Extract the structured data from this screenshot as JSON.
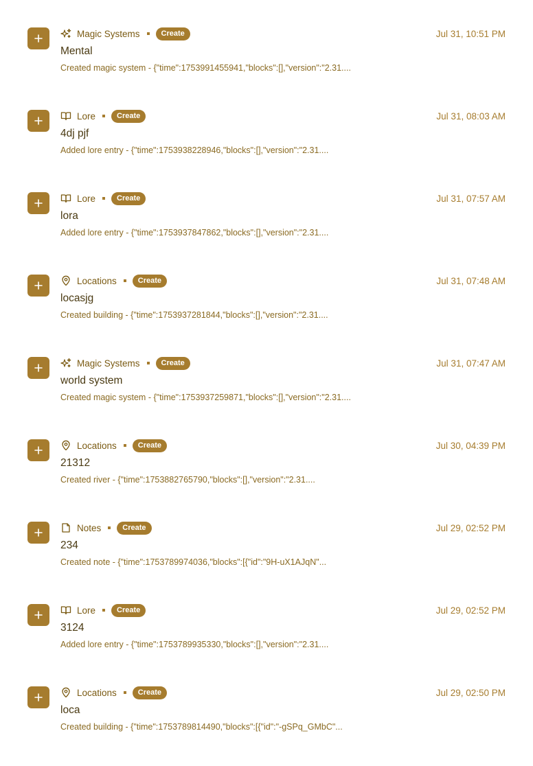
{
  "theme": {
    "accent": "#a67c2e",
    "text_dark": "#4a3a12",
    "text_muted": "#8a6a22"
  },
  "entries": [
    {
      "category": "Magic Systems",
      "category_icon": "sparkles-icon",
      "badge": "Create",
      "title": "Mental",
      "description": "Created magic system - {\"time\":1753991455941,\"blocks\":[],\"version\":\"2.31....",
      "timestamp": "Jul 31, 10:51 PM"
    },
    {
      "category": "Lore",
      "category_icon": "book-open-icon",
      "badge": "Create",
      "title": "4dj pjf",
      "description": "Added lore entry - {\"time\":1753938228946,\"blocks\":[],\"version\":\"2.31....",
      "timestamp": "Jul 31, 08:03 AM"
    },
    {
      "category": "Lore",
      "category_icon": "book-open-icon",
      "badge": "Create",
      "title": "lora",
      "description": "Added lore entry - {\"time\":1753937847862,\"blocks\":[],\"version\":\"2.31....",
      "timestamp": "Jul 31, 07:57 AM"
    },
    {
      "category": "Locations",
      "category_icon": "map-pin-icon",
      "badge": "Create",
      "title": "locasjg",
      "description": "Created building - {\"time\":1753937281844,\"blocks\":[],\"version\":\"2.31....",
      "timestamp": "Jul 31, 07:48 AM"
    },
    {
      "category": "Magic Systems",
      "category_icon": "sparkles-icon",
      "badge": "Create",
      "title": "world system",
      "description": "Created magic system - {\"time\":1753937259871,\"blocks\":[],\"version\":\"2.31....",
      "timestamp": "Jul 31, 07:47 AM"
    },
    {
      "category": "Locations",
      "category_icon": "map-pin-icon",
      "badge": "Create",
      "title": "21312",
      "description": "Created river - {\"time\":1753882765790,\"blocks\":[],\"version\":\"2.31....",
      "timestamp": "Jul 30, 04:39 PM"
    },
    {
      "category": "Notes",
      "category_icon": "file-icon",
      "badge": "Create",
      "title": "234",
      "description": "Created note - {\"time\":1753789974036,\"blocks\":[{\"id\":\"9H-uX1AJqN\"...",
      "timestamp": "Jul 29, 02:52 PM"
    },
    {
      "category": "Lore",
      "category_icon": "book-open-icon",
      "badge": "Create",
      "title": "3124",
      "description": "Added lore entry - {\"time\":1753789935330,\"blocks\":[],\"version\":\"2.31....",
      "timestamp": "Jul 29, 02:52 PM"
    },
    {
      "category": "Locations",
      "category_icon": "map-pin-icon",
      "badge": "Create",
      "title": "loca",
      "description": "Created building - {\"time\":1753789814490,\"blocks\":[{\"id\":\"-gSPq_GMbC\"...",
      "timestamp": "Jul 29, 02:50 PM"
    }
  ]
}
